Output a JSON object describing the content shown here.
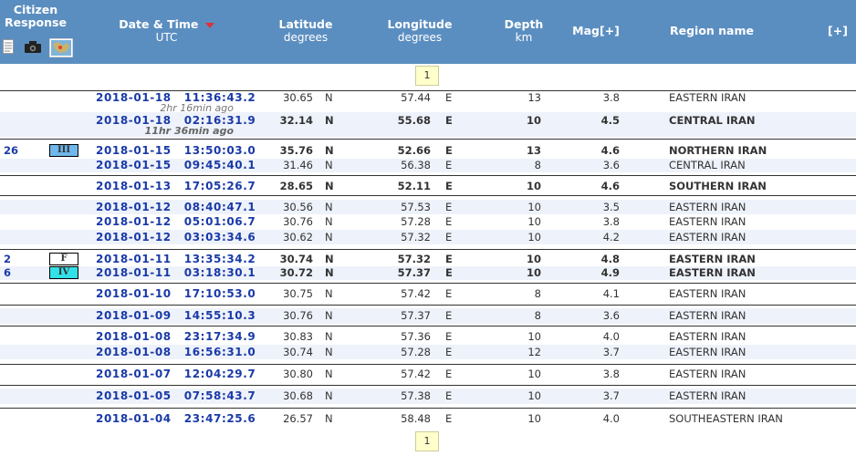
{
  "header": {
    "citizen_response": "Citizen Response",
    "datetime_label": "Date & Time",
    "datetime_unit": "UTC",
    "lat_label": "Latitude",
    "lat_unit": "degrees",
    "lon_label": "Longitude",
    "lon_unit": "degrees",
    "depth_label": "Depth",
    "depth_unit": "km",
    "mag_label": "Mag[+]",
    "region_label": "Region name",
    "expand_label": "[+]"
  },
  "pager": {
    "page": "1"
  },
  "rows": [
    {
      "resp": "",
      "mmi": "",
      "mmi_color": "",
      "date": "2018-01-18",
      "time": "11:36:43.2",
      "ago": "2hr 16min ago",
      "lat": "30.65",
      "ns": "N",
      "lon": "57.44",
      "ew": "E",
      "depth": "13",
      "mag": "3.8",
      "region": "EASTERN IRAN",
      "bold": false
    },
    {
      "resp": "",
      "mmi": "",
      "mmi_color": "",
      "date": "2018-01-18",
      "time": "02:16:31.9",
      "ago": "11hr 36min ago",
      "lat": "32.14",
      "ns": "N",
      "lon": "55.68",
      "ew": "E",
      "depth": "10",
      "mag": "4.5",
      "region": "CENTRAL IRAN",
      "bold": true
    },
    {
      "resp": "26",
      "mmi": "III",
      "mmi_color": "#6fb7ec",
      "date": "2018-01-15",
      "time": "13:50:03.0",
      "ago": "",
      "lat": "35.76",
      "ns": "N",
      "lon": "52.66",
      "ew": "E",
      "depth": "13",
      "mag": "4.6",
      "region": "NORTHERN IRAN",
      "bold": true
    },
    {
      "resp": "",
      "mmi": "",
      "mmi_color": "",
      "date": "2018-01-15",
      "time": "09:45:40.1",
      "ago": "",
      "lat": "31.46",
      "ns": "N",
      "lon": "56.38",
      "ew": "E",
      "depth": "8",
      "mag": "3.6",
      "region": "CENTRAL IRAN",
      "bold": false
    },
    {
      "resp": "",
      "mmi": "",
      "mmi_color": "",
      "date": "2018-01-13",
      "time": "17:05:26.7",
      "ago": "",
      "lat": "28.65",
      "ns": "N",
      "lon": "52.11",
      "ew": "E",
      "depth": "10",
      "mag": "4.6",
      "region": "SOUTHERN IRAN",
      "bold": true
    },
    {
      "resp": "",
      "mmi": "",
      "mmi_color": "",
      "date": "2018-01-12",
      "time": "08:40:47.1",
      "ago": "",
      "lat": "30.56",
      "ns": "N",
      "lon": "57.53",
      "ew": "E",
      "depth": "10",
      "mag": "3.5",
      "region": "EASTERN IRAN",
      "bold": false
    },
    {
      "resp": "",
      "mmi": "",
      "mmi_color": "",
      "date": "2018-01-12",
      "time": "05:01:06.7",
      "ago": "",
      "lat": "30.76",
      "ns": "N",
      "lon": "57.28",
      "ew": "E",
      "depth": "10",
      "mag": "3.8",
      "region": "EASTERN IRAN",
      "bold": false
    },
    {
      "resp": "",
      "mmi": "",
      "mmi_color": "",
      "date": "2018-01-12",
      "time": "03:03:34.6",
      "ago": "",
      "lat": "30.62",
      "ns": "N",
      "lon": "57.32",
      "ew": "E",
      "depth": "10",
      "mag": "4.2",
      "region": "EASTERN IRAN",
      "bold": false
    },
    {
      "resp": "2",
      "mmi": "F",
      "mmi_color": "#ffffff",
      "date": "2018-01-11",
      "time": "13:35:34.2",
      "ago": "",
      "lat": "30.74",
      "ns": "N",
      "lon": "57.32",
      "ew": "E",
      "depth": "10",
      "mag": "4.8",
      "region": "EASTERN IRAN",
      "bold": true
    },
    {
      "resp": "6",
      "mmi": "IV",
      "mmi_color": "#33e0e8",
      "date": "2018-01-11",
      "time": "03:18:30.1",
      "ago": "",
      "lat": "30.72",
      "ns": "N",
      "lon": "57.37",
      "ew": "E",
      "depth": "10",
      "mag": "4.9",
      "region": "EASTERN IRAN",
      "bold": true
    },
    {
      "resp": "",
      "mmi": "",
      "mmi_color": "",
      "date": "2018-01-10",
      "time": "17:10:53.0",
      "ago": "",
      "lat": "30.75",
      "ns": "N",
      "lon": "57.42",
      "ew": "E",
      "depth": "8",
      "mag": "4.1",
      "region": "EASTERN IRAN",
      "bold": false
    },
    {
      "resp": "",
      "mmi": "",
      "mmi_color": "",
      "date": "2018-01-09",
      "time": "14:55:10.3",
      "ago": "",
      "lat": "30.76",
      "ns": "N",
      "lon": "57.37",
      "ew": "E",
      "depth": "8",
      "mag": "3.6",
      "region": "EASTERN IRAN",
      "bold": false
    },
    {
      "resp": "",
      "mmi": "",
      "mmi_color": "",
      "date": "2018-01-08",
      "time": "23:17:34.9",
      "ago": "",
      "lat": "30.83",
      "ns": "N",
      "lon": "57.36",
      "ew": "E",
      "depth": "10",
      "mag": "4.0",
      "region": "EASTERN IRAN",
      "bold": false
    },
    {
      "resp": "",
      "mmi": "",
      "mmi_color": "",
      "date": "2018-01-08",
      "time": "16:56:31.0",
      "ago": "",
      "lat": "30.74",
      "ns": "N",
      "lon": "57.28",
      "ew": "E",
      "depth": "12",
      "mag": "3.7",
      "region": "EASTERN IRAN",
      "bold": false
    },
    {
      "resp": "",
      "mmi": "",
      "mmi_color": "",
      "date": "2018-01-07",
      "time": "12:04:29.7",
      "ago": "",
      "lat": "30.80",
      "ns": "N",
      "lon": "57.42",
      "ew": "E",
      "depth": "10",
      "mag": "3.8",
      "region": "EASTERN IRAN",
      "bold": false
    },
    {
      "resp": "",
      "mmi": "",
      "mmi_color": "",
      "date": "2018-01-05",
      "time": "07:58:43.7",
      "ago": "",
      "lat": "30.68",
      "ns": "N",
      "lon": "57.38",
      "ew": "E",
      "depth": "10",
      "mag": "3.7",
      "region": "EASTERN IRAN",
      "bold": false
    },
    {
      "resp": "",
      "mmi": "",
      "mmi_color": "",
      "date": "2018-01-04",
      "time": "23:47:25.6",
      "ago": "",
      "lat": "26.57",
      "ns": "N",
      "lon": "58.48",
      "ew": "E",
      "depth": "10",
      "mag": "4.0",
      "region": "SOUTHEASTERN IRAN",
      "bold": false
    }
  ],
  "colors": {
    "header_bg": "#5b8ec0",
    "date_link": "#1a3aa8",
    "alt_row": "#eef2fa"
  }
}
